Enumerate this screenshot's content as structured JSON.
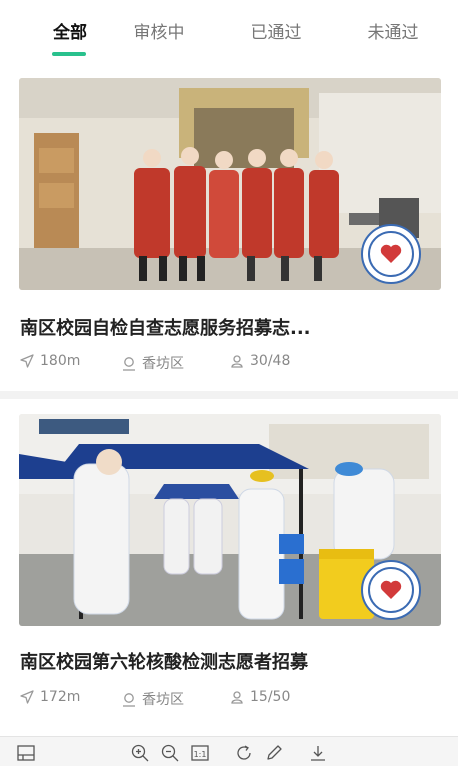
{
  "tabs": [
    {
      "label": "全部",
      "active": true
    },
    {
      "label": "审核中"
    },
    {
      "label": "已通过"
    },
    {
      "label": "未通过"
    }
  ],
  "cards": [
    {
      "title": "南区校园自检自查志愿服务招募志...",
      "distance": "180m",
      "location": "香坊区",
      "participants": "30/48"
    },
    {
      "title": "南区校园第六轮核酸检测志愿者招募",
      "distance": "172m",
      "location": "香坊区",
      "participants": "15/50"
    }
  ],
  "colors": {
    "accent": "#29c18d",
    "meta_text": "#888888",
    "divider": "#f2f2f2"
  },
  "toolbar_icons": [
    "layout-icon",
    "zoom-in-icon",
    "zoom-out-icon",
    "actual-size-icon",
    "rotate-icon",
    "edit-icon",
    "download-icon"
  ],
  "toolbar": {
    "actual_size_label": "1:1"
  }
}
